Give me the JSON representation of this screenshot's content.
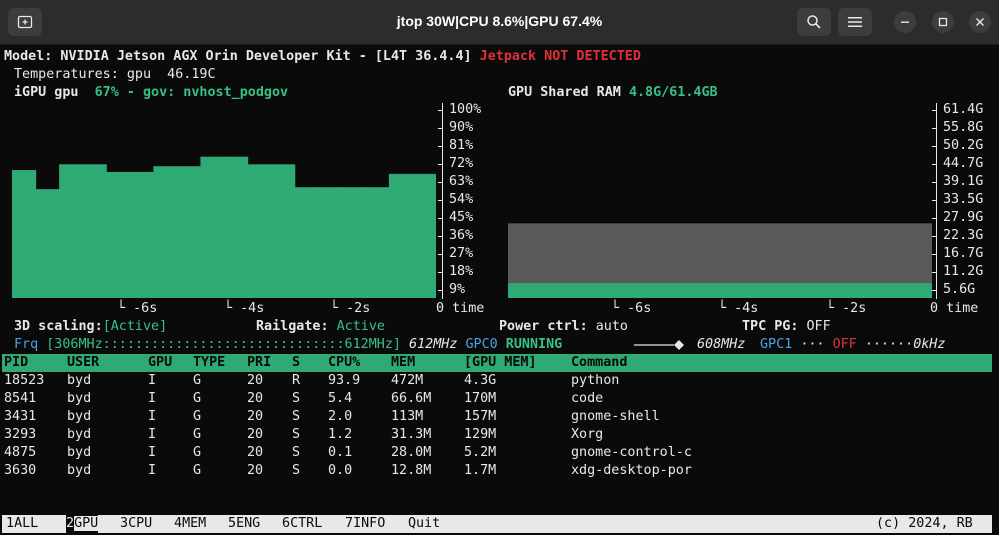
{
  "window": {
    "title": "jtop 30W|CPU 8.6%|GPU 67.4%"
  },
  "header": {
    "model": "Model: NVIDIA Jetson AGX Orin Developer Kit - [L4T 36.4.4]",
    "jetpack": "Jetpack NOT DETECTED",
    "temps_label": "Temperatures:",
    "temps_value": "gpu  46.19C"
  },
  "gpu_panel": {
    "title": "iGPU gpu",
    "status": "67% - gov: nvhost_podgov",
    "ylabels": [
      "100%",
      "90%",
      "81%",
      "72%",
      "63%",
      "54%",
      "45%",
      "36%",
      "27%",
      "18%",
      "9%"
    ],
    "xlabels": [
      "-6s",
      "-4s",
      "-2s",
      "0"
    ],
    "time_label": "time"
  },
  "ram_panel": {
    "title": "GPU Shared RAM",
    "value": "4.8G/61.4GB",
    "ylabels": [
      "61.4G",
      "55.8G",
      "50.2G",
      "44.7G",
      "39.1G",
      "33.5G",
      "27.9G",
      "22.3G",
      "16.7G",
      "11.2G",
      "5.6G"
    ],
    "xlabels": [
      "-6s",
      "-4s",
      "-2s",
      "0"
    ],
    "time_label": "time"
  },
  "chart_data": [
    {
      "type": "bar",
      "title": "iGPU gpu",
      "unit": "%",
      "ylim": [
        0,
        100
      ],
      "values": [
        67,
        57,
        70,
        70,
        66,
        66,
        69,
        69,
        74,
        74,
        70,
        70,
        58,
        58,
        58,
        58,
        65,
        65
      ]
    },
    {
      "type": "bar",
      "title": "GPU Shared RAM",
      "unit": "GB",
      "ylim": [
        0,
        61.4
      ],
      "values": [
        24.0,
        4.8
      ]
    }
  ],
  "status_line": {
    "scaling_label": "3D scaling:",
    "scaling_value": "[Active]",
    "railgate_label": "Railgate:",
    "railgate_value": "Active",
    "powerctrl_label": "Power ctrl:",
    "powerctrl_value": "auto",
    "tpcpg_label": "TPC PG:",
    "tpcpg_value": "OFF"
  },
  "freq_line": {
    "label": "Frq",
    "bar": "[306MHz::::::::::::::::::::::::::::::612MHz]",
    "cur": "612MHz",
    "gpc0": "GPC0",
    "running": "RUNNING",
    "gpc0_freq": "608MHz",
    "gpc1": "GPC1",
    "dots": "···",
    "off": "OFF",
    "dots2": "······",
    "gpc1_freq": "0kHz"
  },
  "process_table": {
    "columns": [
      "PID",
      "USER",
      "GPU",
      "TYPE",
      "PRI",
      "S",
      "CPU%",
      "MEM",
      "[GPU MEM]",
      "Command"
    ],
    "rows": [
      [
        "18523",
        "byd",
        "I",
        "G",
        "20",
        "R",
        "93.9",
        "472M",
        "4.3G",
        "python"
      ],
      [
        "8541",
        "byd",
        "I",
        "G",
        "20",
        "S",
        "5.4",
        "66.6M",
        "170M",
        "code"
      ],
      [
        "3431",
        "byd",
        "I",
        "G",
        "20",
        "S",
        "2.0",
        "113M",
        "157M",
        "gnome-shell"
      ],
      [
        "3293",
        "byd",
        "I",
        "G",
        "20",
        "S",
        "1.2",
        "31.3M",
        "129M",
        "Xorg"
      ],
      [
        "4875",
        "byd",
        "I",
        "G",
        "20",
        "S",
        "0.1",
        "28.0M",
        "5.2M",
        "gnome-control-c"
      ],
      [
        "3630",
        "byd",
        "I",
        "G",
        "20",
        "S",
        "0.0",
        "12.8M",
        "1.7M",
        "xdg-desktop-por"
      ]
    ]
  },
  "footer": {
    "tabs": [
      {
        "num": "1",
        "label": "ALL"
      },
      {
        "num": "2",
        "label": "GPU"
      },
      {
        "num": "3",
        "label": "CPU"
      },
      {
        "num": "4",
        "label": "MEM"
      },
      {
        "num": "5",
        "label": "ENG"
      },
      {
        "num": "6",
        "label": "CTRL"
      },
      {
        "num": "7",
        "label": "INFO"
      }
    ],
    "quit": "Quit",
    "copyright": "(c) 2024, RB"
  },
  "colors": {
    "accent_green": "#2faa74",
    "alert_red": "#e0313a",
    "link_blue": "#4aa3df",
    "ram_gray": "#5a5a5a"
  }
}
